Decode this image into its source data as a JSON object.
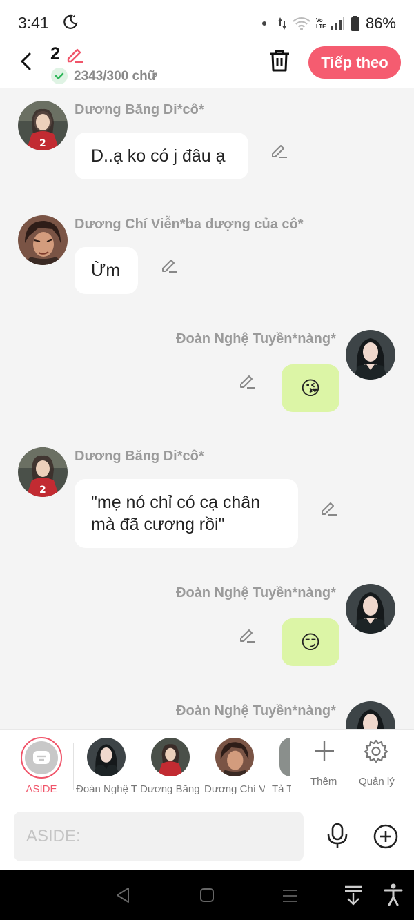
{
  "status_bar": {
    "time": "3:41",
    "battery": "86%",
    "network_label": "Vo LTE"
  },
  "header": {
    "count": "2",
    "word_count": "2343/300 chữ",
    "next_label": "Tiếp theo"
  },
  "messages": [
    {
      "sender": "Dương Băng Di*cô*",
      "text": "D..ạ ko có j đâu ạ",
      "side": "left"
    },
    {
      "sender": "Dương Chí Viễn*ba dượng của cô*",
      "text": "Ừm",
      "side": "left"
    },
    {
      "sender": "Đoàn Nghệ Tuyền*nàng*",
      "text": "😘",
      "side": "right"
    },
    {
      "sender": "Dương Băng Di*cô*",
      "text": "\"mẹ nó chỉ có cạ chân mà đã cương rồi\"",
      "side": "left"
    },
    {
      "sender": "Đoàn Nghệ Tuyền*nàng*",
      "text": "😏",
      "side": "right"
    },
    {
      "sender": "Đoàn Nghệ Tuyền*nàng*",
      "text": "",
      "side": "right"
    }
  ],
  "character_bar": {
    "aside_label": "ASIDE",
    "characters": [
      "Đoàn Nghệ Tuyền",
      "Dương Băng Di",
      "Dương Chí Viễn",
      "Tả T"
    ],
    "add_label": "Thêm",
    "manage_label": "Quản lý"
  },
  "input": {
    "placeholder": "ASIDE:"
  },
  "colors": {
    "accent": "#f55c70",
    "user_bubble": "#dcf5a6",
    "background": "#f4f4f4"
  }
}
